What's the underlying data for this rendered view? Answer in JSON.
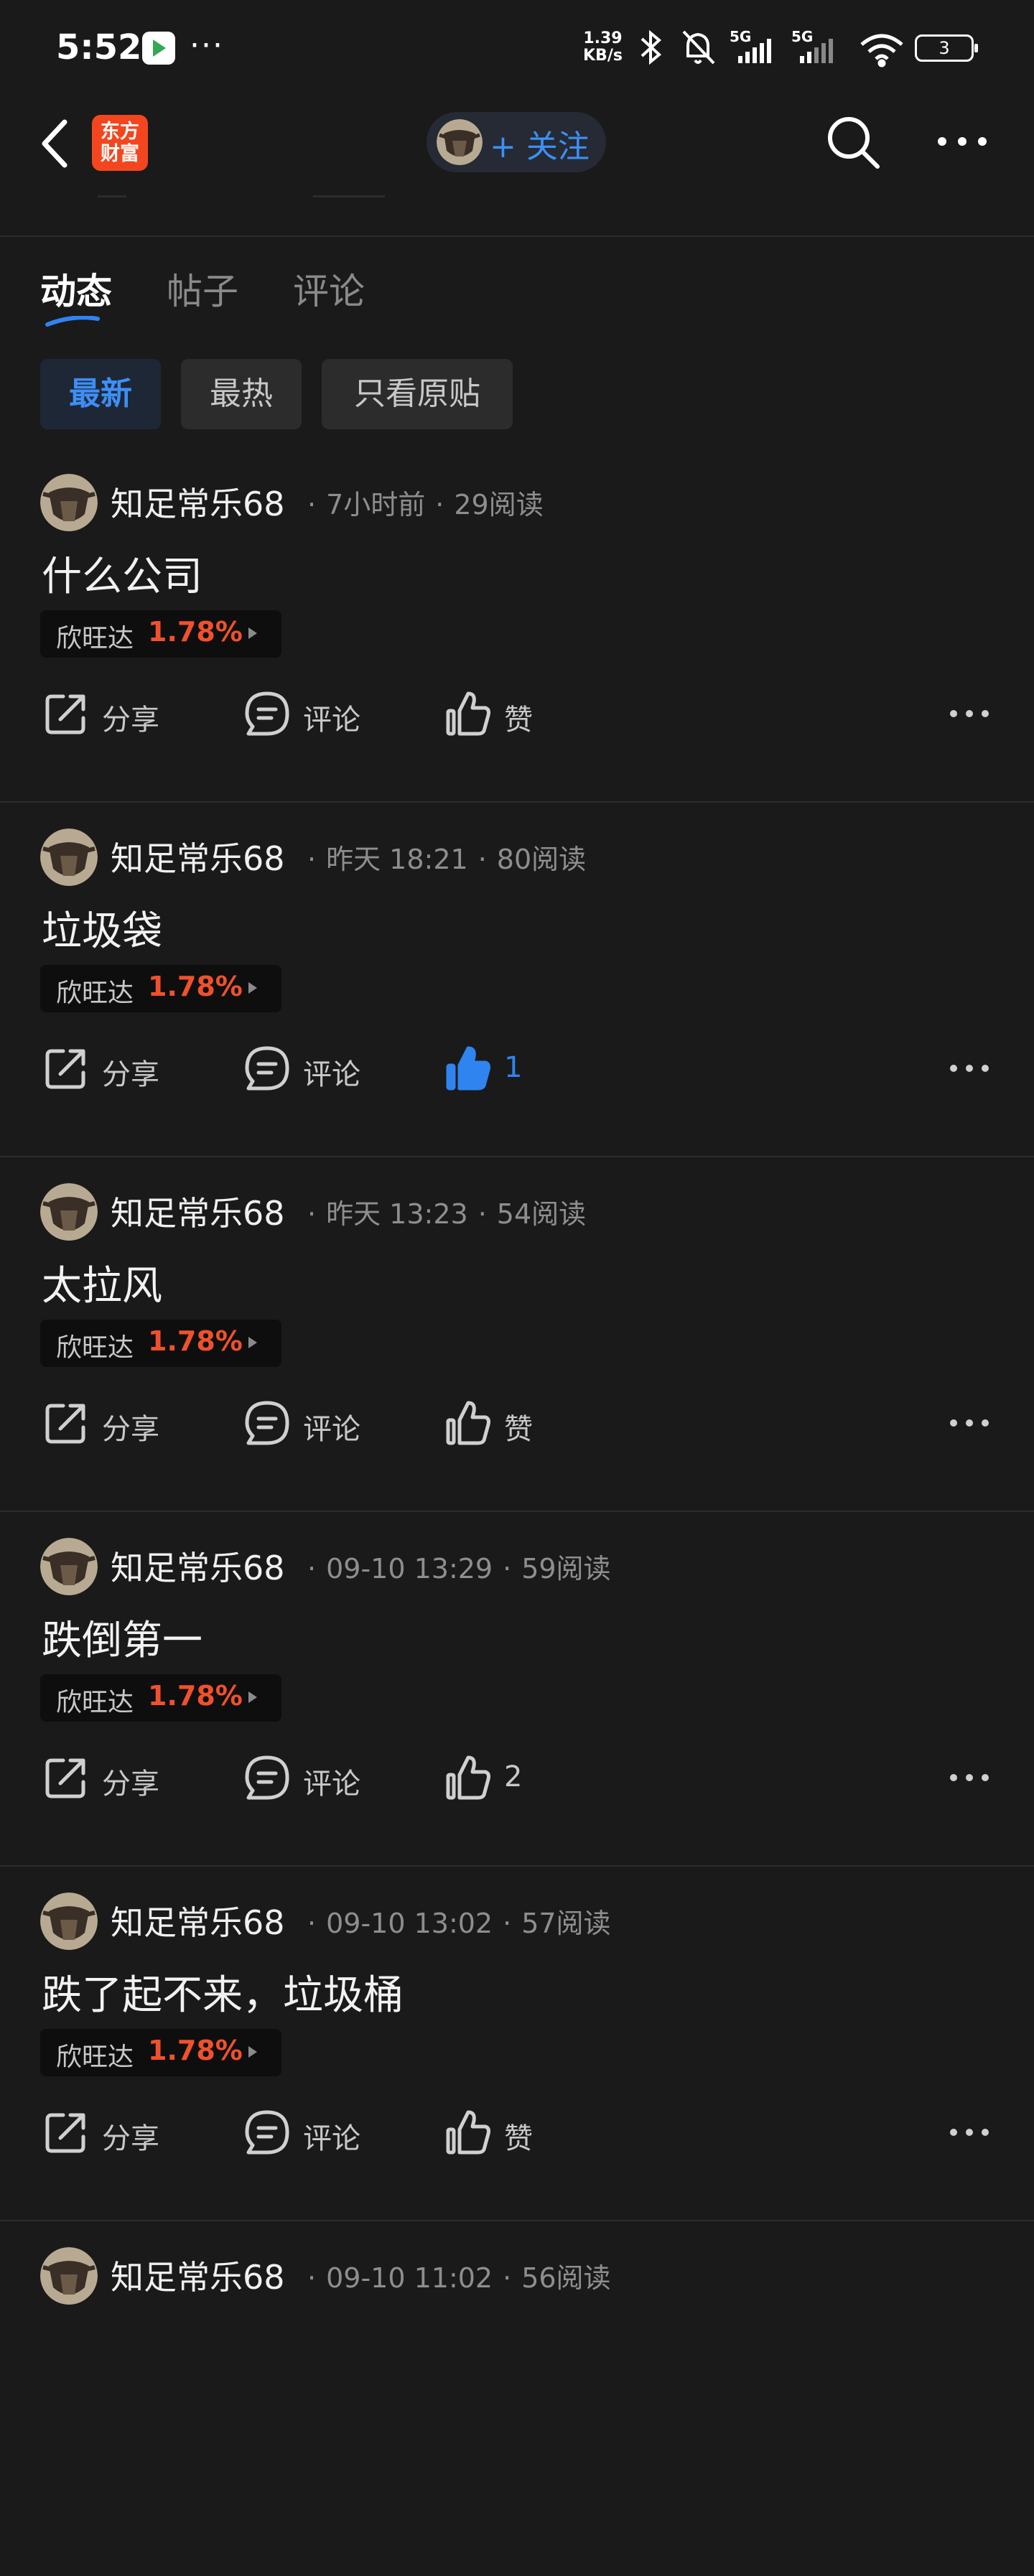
{
  "status_bar": {
    "time": "5:52",
    "app_icon": "play-store-icon",
    "more": "···",
    "net_speed_value": "1.39",
    "net_speed_unit": "KB/s",
    "signal_1": "5G",
    "signal_2": "5G",
    "battery": "3"
  },
  "nav": {
    "logo_text_1": "东方",
    "logo_text_2": "财富",
    "follow_label": "+ 关注"
  },
  "tabs": [
    "动态",
    "帖子",
    "评论"
  ],
  "filters": [
    "最新",
    "最热",
    "只看原贴"
  ],
  "posts": [
    {
      "author": "知足常乐68",
      "time": "7小时前",
      "reads": "29阅读",
      "content": "什么公司",
      "stock": "欣旺达",
      "pct": "1.78%",
      "share": "分享",
      "comment": "评论",
      "like": "赞",
      "liked": false
    },
    {
      "author": "知足常乐68",
      "time": "昨天 18:21",
      "reads": "80阅读",
      "content": "垃圾袋",
      "stock": "欣旺达",
      "pct": "1.78%",
      "share": "分享",
      "comment": "评论",
      "like": "1",
      "liked": true
    },
    {
      "author": "知足常乐68",
      "time": "昨天 13:23",
      "reads": "54阅读",
      "content": "太拉风",
      "stock": "欣旺达",
      "pct": "1.78%",
      "share": "分享",
      "comment": "评论",
      "like": "赞",
      "liked": false
    },
    {
      "author": "知足常乐68",
      "time": "09-10 13:29",
      "reads": "59阅读",
      "content": "跌倒第一",
      "stock": "欣旺达",
      "pct": "1.78%",
      "share": "分享",
      "comment": "评论",
      "like": "2",
      "liked": false
    },
    {
      "author": "知足常乐68",
      "time": "09-10 13:02",
      "reads": "57阅读",
      "content": "跌了起不来，垃圾桶",
      "stock": "欣旺达",
      "pct": "1.78%",
      "share": "分享",
      "comment": "评论",
      "like": "赞",
      "liked": false
    },
    {
      "author": "知足常乐68",
      "time": "09-10 11:02",
      "reads": "56阅读"
    }
  ],
  "colors": {
    "background": "#1a1a1a",
    "accent_blue": "#3d8ff5",
    "stock_red": "#f0512c",
    "liked_blue": "#2f84f0"
  }
}
